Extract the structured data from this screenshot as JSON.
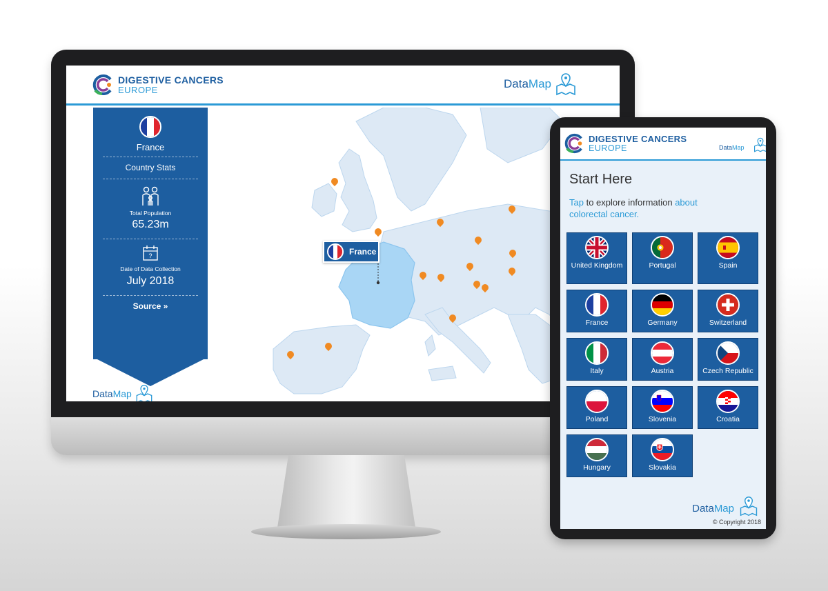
{
  "brand": {
    "name_line1": "DIGESTIVE CANCERS",
    "name_line2": "EUROPE",
    "datamap_part1": "Data",
    "datamap_part2": "Map",
    "colors": {
      "primary": "#1d5ea0",
      "accent": "#2b9ad6",
      "pin": "#f08a22",
      "map_land": "#dde9f5",
      "map_highlight": "#a9d6f5"
    }
  },
  "desktop": {
    "sidebar": {
      "country": "France",
      "country_stats_label": "Country Stats",
      "population_label": "Total Population",
      "population_value": "65.23m",
      "date_label": "Date of Data Collection",
      "date_value": "July 2018",
      "source_label": "Source »",
      "population_icon": "family-icon",
      "calendar_icon": "calendar-icon",
      "calendar_glyph": "?"
    },
    "map": {
      "selected_country_label": "France"
    }
  },
  "tablet": {
    "start_title": "Start Here",
    "intro_tap": "Tap",
    "intro_middle": " to explore information ",
    "intro_link": "about colorectal cancer.",
    "countries": [
      {
        "name": "United Kingdom",
        "flag": "uk"
      },
      {
        "name": "Portugal",
        "flag": "pt"
      },
      {
        "name": "Spain",
        "flag": "es"
      },
      {
        "name": "France",
        "flag": "fr"
      },
      {
        "name": "Germany",
        "flag": "de"
      },
      {
        "name": "Switzerland",
        "flag": "ch"
      },
      {
        "name": "Italy",
        "flag": "it"
      },
      {
        "name": "Austria",
        "flag": "at"
      },
      {
        "name": "Czech Republic",
        "flag": "cz"
      },
      {
        "name": "Poland",
        "flag": "pl"
      },
      {
        "name": "Slovenia",
        "flag": "si"
      },
      {
        "name": "Croatia",
        "flag": "hr"
      },
      {
        "name": "Hungary",
        "flag": "hu"
      },
      {
        "name": "Slovakia",
        "flag": "sk"
      }
    ],
    "copyright": "© Copyright 2018"
  }
}
